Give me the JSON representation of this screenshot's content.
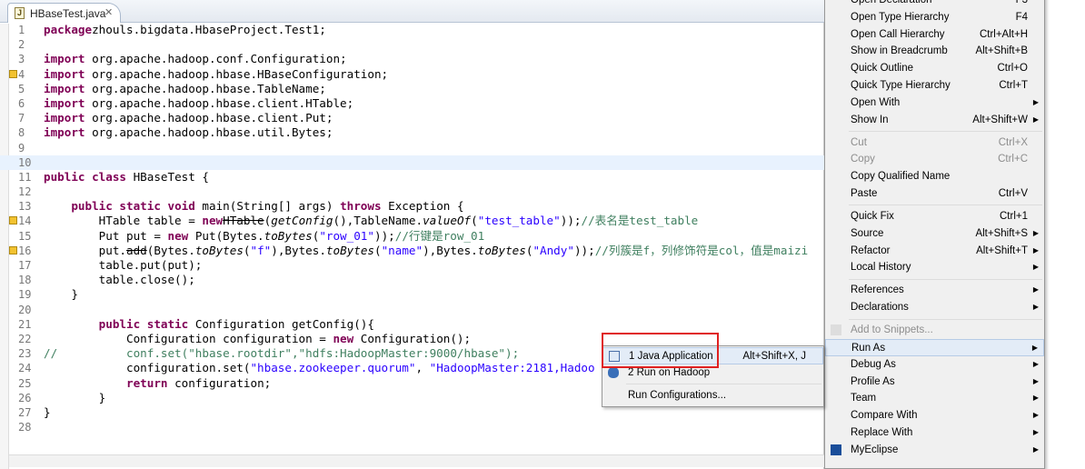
{
  "tab": {
    "title": "HBaseTest.java",
    "icon": "java-file-icon"
  },
  "code": [
    [
      [
        "kw",
        "package"
      ],
      [
        "",
        "zhouls.bigdata.HbaseProject.Test1;"
      ]
    ],
    [],
    [
      [
        "kw",
        "import"
      ],
      [
        "",
        " org.apache.hadoop.conf.Configuration;"
      ]
    ],
    [
      [
        "kw",
        "import"
      ],
      [
        "",
        " org.apache.hadoop.hbase.HBaseConfiguration;"
      ]
    ],
    [
      [
        "kw",
        "import"
      ],
      [
        "",
        " org.apache.hadoop.hbase.TableName;"
      ]
    ],
    [
      [
        "kw",
        "import"
      ],
      [
        "",
        " org.apache.hadoop.hbase.client.HTable;"
      ]
    ],
    [
      [
        "kw",
        "import"
      ],
      [
        "",
        " org.apache.hadoop.hbase.client.Put;"
      ]
    ],
    [
      [
        "kw",
        "import"
      ],
      [
        "",
        " org.apache.hadoop.hbase.util.Bytes;"
      ]
    ],
    [],
    [],
    [
      [
        "kw",
        "public class"
      ],
      [
        "",
        " HBaseTest {"
      ]
    ],
    [],
    [
      [
        "",
        "    "
      ],
      [
        "kw",
        "public static void"
      ],
      [
        "",
        " main(String[] args) "
      ],
      [
        "kw",
        "throws"
      ],
      [
        "",
        " Exception {"
      ]
    ],
    [
      [
        "",
        "        HTable table = "
      ],
      [
        "kw",
        "new"
      ],
      [
        "",
        "",
        " "
      ],
      [
        "st",
        "HTable"
      ],
      [
        "",
        "("
      ],
      [
        "it",
        "getConfig"
      ],
      [
        "",
        "(),TableName."
      ],
      [
        "it",
        "valueOf"
      ],
      [
        "",
        "("
      ],
      [
        "str",
        "\"test_table\""
      ],
      [
        "",
        "));"
      ],
      [
        "cm",
        "//表名是test_table"
      ]
    ],
    [
      [
        "",
        "        Put put = "
      ],
      [
        "kw",
        "new"
      ],
      [
        "",
        " Put(Bytes."
      ],
      [
        "it",
        "toBytes"
      ],
      [
        "",
        "("
      ],
      [
        "str",
        "\"row_01\""
      ],
      [
        "",
        "));"
      ],
      [
        "cm",
        "//行键是row_01"
      ]
    ],
    [
      [
        "",
        "        put."
      ],
      [
        "st",
        "add"
      ],
      [
        "",
        "(Bytes."
      ],
      [
        "it",
        "toBytes"
      ],
      [
        "",
        "("
      ],
      [
        "str",
        "\"f\""
      ],
      [
        "",
        "),Bytes."
      ],
      [
        "it",
        "toBytes"
      ],
      [
        "",
        "("
      ],
      [
        "str",
        "\"name\""
      ],
      [
        "",
        "),Bytes."
      ],
      [
        "it",
        "toBytes"
      ],
      [
        "",
        "("
      ],
      [
        "str",
        "\"Andy\""
      ],
      [
        "",
        "));"
      ],
      [
        "cm",
        "//列簇是f，列修饰符是col，值是maizi"
      ]
    ],
    [
      [
        "",
        "        table.put(put);"
      ]
    ],
    [
      [
        "",
        "        table.close();"
      ]
    ],
    [
      [
        "",
        "    }"
      ]
    ],
    [],
    [
      [
        "",
        "        "
      ],
      [
        "kw",
        "public static"
      ],
      [
        "",
        " Configuration getConfig(){"
      ]
    ],
    [
      [
        "",
        "            Configuration configuration = "
      ],
      [
        "kw",
        "new"
      ],
      [
        "",
        " Configuration();"
      ]
    ],
    [
      [
        "cm",
        "//          conf.set(\"hbase.rootdir\",\"hdfs:HadoopMaster:9000/hbase\");"
      ]
    ],
    [
      [
        "",
        "            configuration.set("
      ],
      [
        "str",
        "\"hbase.zookeeper.quorum\""
      ],
      [
        "",
        ", "
      ],
      [
        "str",
        "\"HadoopMaster:2181,Hadoo"
      ]
    ],
    [
      [
        "",
        "            "
      ],
      [
        "kw",
        "return"
      ],
      [
        "",
        " configuration;"
      ]
    ],
    [
      [
        "",
        "        }"
      ]
    ],
    [
      [
        "",
        "}"
      ]
    ],
    []
  ],
  "warning_lines": [
    4,
    14,
    16
  ],
  "current_line": 10,
  "context_menu": [
    {
      "label": "Open Declaration",
      "shortcut": "F3"
    },
    {
      "label": "Open Type Hierarchy",
      "shortcut": "F4"
    },
    {
      "label": "Open Call Hierarchy",
      "shortcut": "Ctrl+Alt+H"
    },
    {
      "label": "Show in Breadcrumb",
      "shortcut": "Alt+Shift+B"
    },
    {
      "label": "Quick Outline",
      "shortcut": "Ctrl+O"
    },
    {
      "label": "Quick Type Hierarchy",
      "shortcut": "Ctrl+T"
    },
    {
      "label": "Open With",
      "submenu": true
    },
    {
      "label": "Show In",
      "shortcut": "Alt+Shift+W",
      "submenu": true,
      "sep": true
    },
    {
      "label": "Cut",
      "shortcut": "Ctrl+X",
      "disabled": true
    },
    {
      "label": "Copy",
      "shortcut": "Ctrl+C",
      "disabled": true
    },
    {
      "label": "Copy Qualified Name"
    },
    {
      "label": "Paste",
      "shortcut": "Ctrl+V",
      "sep": true
    },
    {
      "label": "Quick Fix",
      "shortcut": "Ctrl+1"
    },
    {
      "label": "Source",
      "shortcut": "Alt+Shift+S",
      "submenu": true
    },
    {
      "label": "Refactor",
      "shortcut": "Alt+Shift+T",
      "submenu": true
    },
    {
      "label": "Local History",
      "submenu": true,
      "sep": true
    },
    {
      "label": "References",
      "submenu": true
    },
    {
      "label": "Declarations",
      "submenu": true,
      "sep": true
    },
    {
      "label": "Add to Snippets...",
      "disabled": true,
      "icon": "snippet-icon"
    },
    {
      "label": "Run As",
      "submenu": true,
      "highlighted": true
    },
    {
      "label": "Debug As",
      "submenu": true
    },
    {
      "label": "Profile As",
      "submenu": true
    },
    {
      "label": "Team",
      "submenu": true
    },
    {
      "label": "Compare With",
      "submenu": true
    },
    {
      "label": "Replace With",
      "submenu": true
    },
    {
      "label": "MyEclipse",
      "submenu": true,
      "icon": "myeclipse-icon"
    }
  ],
  "run_as_submenu": [
    {
      "label": "1 Java Application",
      "shortcut": "Alt+Shift+X, J",
      "icon": "java-app-icon",
      "highlighted": true
    },
    {
      "label": "2 Run on Hadoop",
      "icon": "hadoop-elephant-icon",
      "sep": true
    },
    {
      "label": "Run Configurations..."
    }
  ],
  "colors": {
    "keyword": "#7f0055",
    "string": "#2a00ff",
    "comment": "#3f7f5f",
    "highlight_box": "#e02020"
  }
}
